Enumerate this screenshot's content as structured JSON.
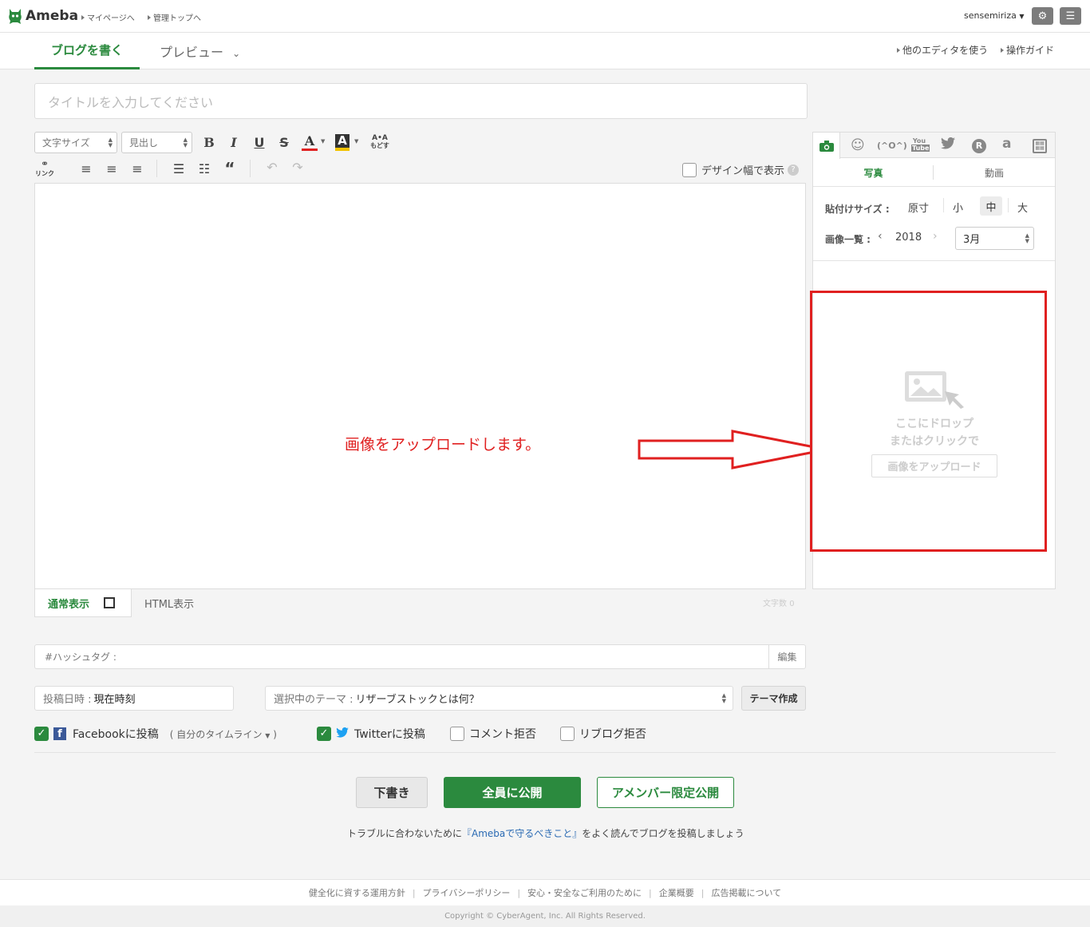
{
  "header": {
    "brand": "Ameba",
    "links": [
      "マイページへ",
      "管理トップへ"
    ],
    "username": "sensemiriza"
  },
  "subnav": {
    "tab_write": "ブログを書く",
    "tab_preview": "プレビュー",
    "right_links": [
      "他のエディタを使う",
      "操作ガイド"
    ]
  },
  "editor": {
    "title_placeholder": "タイトルを入力してください",
    "font_size_label": "文字サイズ",
    "heading_label": "見出し",
    "link_label": "リンク",
    "revert_label": "もどす",
    "design_width_label": "デザイン幅で表示",
    "annotation_text": "画像をアップロードします。",
    "view_normal": "通常表示",
    "view_html": "HTML表示",
    "char_count_label": "文字数",
    "char_count": "0"
  },
  "sidepanel": {
    "tabs": [
      "写真",
      "動画"
    ],
    "paste_size_label": "貼付けサイズ :",
    "sizes": [
      "原寸",
      "小",
      "中",
      "大"
    ],
    "selected_size": "中",
    "image_list_label": "画像一覧 :",
    "year": "2018",
    "month": "3月",
    "drop_line1": "ここにドロップ",
    "drop_line2": "またはクリックで",
    "upload_button": "画像をアップロード"
  },
  "form": {
    "hashtag_label": "#ハッシュタグ :",
    "edit_label": "編集",
    "post_date_label": "投稿日時 :",
    "post_date_value": "現在時刻",
    "theme_label": "選択中のテーマ :",
    "theme_value": "リザーブストックとは何？",
    "theme_create": "テーマ作成",
    "facebook_label": "Facebookに投稿",
    "facebook_target": "( 自分のタイムライン",
    "facebook_close": ")",
    "twitter_label": "Twitterに投稿",
    "comment_refuse": "コメント拒否",
    "reblog_refuse": "リブログ拒否"
  },
  "actions": {
    "draft": "下書き",
    "publish_all": "全員に公開",
    "publish_members": "アメンバー限定公開",
    "notice_before": "トラブルに合わないために",
    "notice_link": "『Amebaで守るべきこと』",
    "notice_after": "をよく読んでブログを投稿しましょう"
  },
  "footer": {
    "links": [
      "健全化に資する運用方針",
      "プライバシーポリシー",
      "安心・安全なご利用のために",
      "企業概要",
      "広告掲載について"
    ],
    "copyright": "Copyright © CyberAgent, Inc. All Rights Reserved."
  },
  "colors": {
    "brand_green": "#2b8a3e",
    "annotation_red": "#e02020"
  }
}
